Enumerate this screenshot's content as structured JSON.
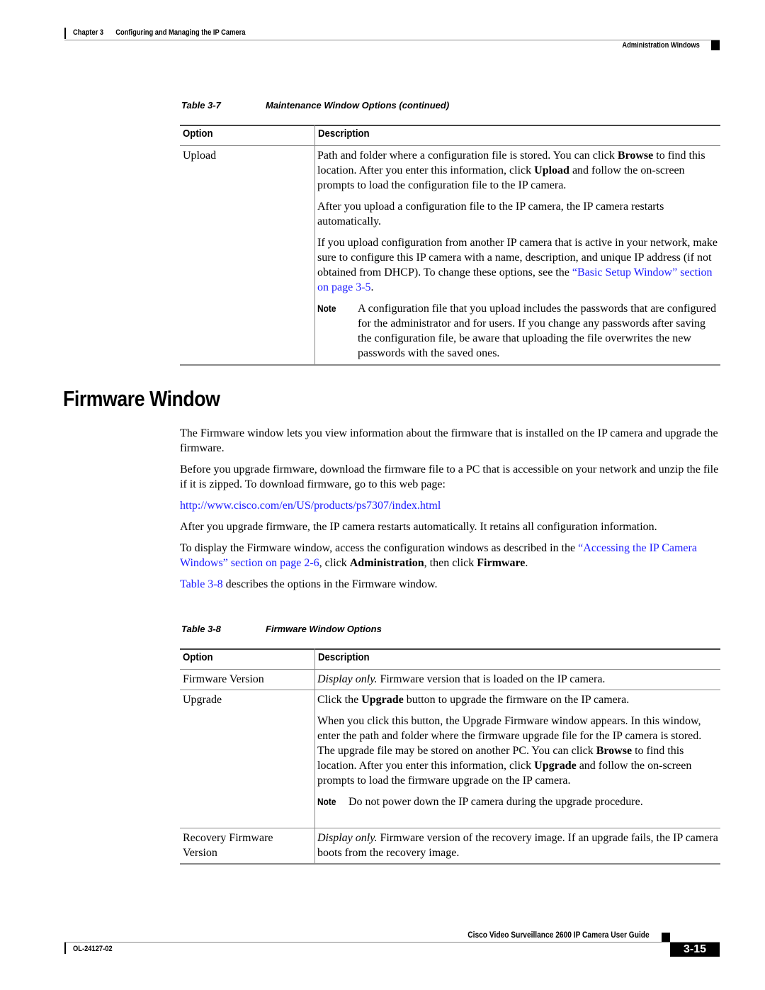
{
  "header": {
    "chapter": "Chapter 3",
    "chapter_title": "Configuring and Managing the IP Camera",
    "section": "Administration Windows"
  },
  "table_3_7": {
    "label": "Table",
    "number": "3-7",
    "title": "Maintenance Window Options (continued)",
    "col_option": "Option",
    "col_description": "Description",
    "rows": [
      {
        "option": "Upload",
        "p1_a": "Path and folder where a configuration file is stored. You can click ",
        "p1_b": "Browse",
        "p1_c": " to find this location. After you enter this information, click ",
        "p1_d": "Upload",
        "p1_e": " and follow the on-screen prompts to load the configuration file to the IP camera.",
        "p2": "After you upload a configuration file to the IP camera, the IP camera restarts automatically.",
        "p3_a": "If you upload configuration from another IP camera that is active in your network, make sure to configure this IP camera with a name, description, and unique IP address (if not obtained from DHCP). To change these options, see the ",
        "p3_link": "“Basic Setup Window” section on page 3-5",
        "p3_end": ".",
        "note_label": "Note",
        "note_text": "A configuration file that you upload includes the passwords that are configured for the administrator and for users. If you change any passwords after saving the configuration file, be aware that uploading the file overwrites the new passwords with the saved ones."
      }
    ]
  },
  "section": {
    "title": "Firmware Window",
    "p1": "The Firmware window lets you view information about the firmware that is installed on the IP camera and upgrade the firmware.",
    "p2": "Before you upgrade firmware, download the firmware file to a PC that is accessible on your network and unzip the file if it is zipped. To download firmware, go to this web page:",
    "url": "http://www.cisco.com/en/US/products/ps7307/index.html",
    "p3": "After you upgrade firmware, the IP camera restarts automatically. It retains all configuration information.",
    "p4_a": "To display the Firmware window, access the configuration windows as described in the ",
    "p4_link": "“Accessing the IP Camera Windows” section on page 2-6",
    "p4_b": ", click ",
    "p4_bold1": "Administration",
    "p4_c": ", then click ",
    "p4_bold2": "Firmware",
    "p4_d": ".",
    "p5_link": "Table 3-8",
    "p5_text": " describes the options in the Firmware window."
  },
  "table_3_8": {
    "label": "Table",
    "number": "3-8",
    "title": "Firmware Window Options",
    "col_option": "Option",
    "col_description": "Description",
    "rows": [
      {
        "option": "Firmware Version",
        "desc_ital": "Display only.",
        "desc": " Firmware version that is loaded on the IP camera."
      },
      {
        "option": "Upgrade",
        "p1_a": "Click the ",
        "p1_b": "Upgrade",
        "p1_c": " button to upgrade the firmware on the IP camera.",
        "p2_a": "When you click this button, the Upgrade Firmware window appears. In this window, enter the path and folder where the firmware upgrade file for the IP camera is stored. The upgrade file may be stored on another PC. You can click ",
        "p2_b": "Browse",
        "p2_c": " to find this location. After you enter this information, click ",
        "p2_d": "Upgrade",
        "p2_e": " and follow the on-screen prompts to load the firmware upgrade on the IP camera.",
        "note_label": "Note",
        "note_text": "Do not power down the IP camera during the upgrade procedure."
      },
      {
        "option_line1": "Recovery Firmware",
        "option_line2": "Version",
        "desc_ital": "Display only.",
        "desc": " Firmware version of the recovery image. If an upgrade fails, the IP camera boots from the recovery image."
      }
    ]
  },
  "footer": {
    "guide_title": "Cisco Video Surveillance 2600 IP Camera User Guide",
    "doc_number": "OL-24127-02",
    "page_number": "3-15"
  }
}
